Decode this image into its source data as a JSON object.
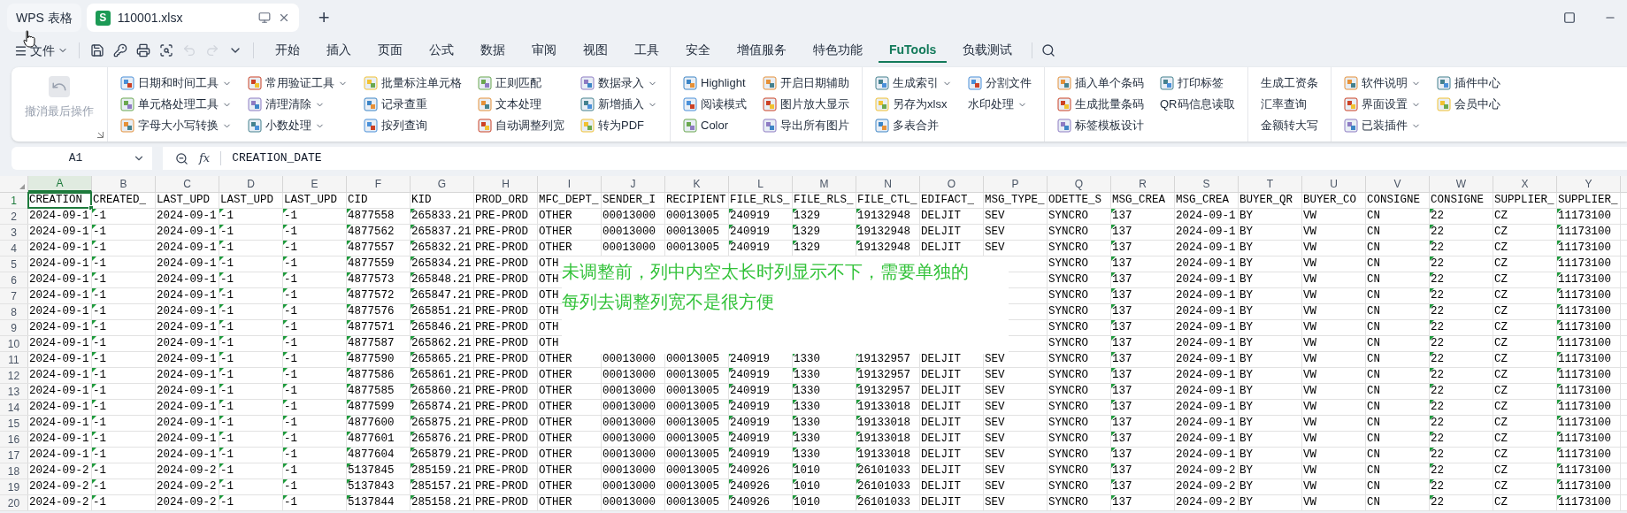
{
  "doc_tabs": [
    {
      "label": "WPS 表格",
      "kind": "home",
      "selected": false
    },
    {
      "label": "110001.xlsx",
      "kind": "sheet",
      "badge": "S",
      "selected": true
    }
  ],
  "new_tab": "+",
  "menu": {
    "file_label": "文件",
    "quick_tools": [
      {
        "kind": "save",
        "disabled": false
      },
      {
        "kind": "key",
        "disabled": false
      },
      {
        "kind": "print",
        "disabled": false
      },
      {
        "kind": "preview",
        "disabled": false
      },
      {
        "kind": "undo",
        "disabled": true
      },
      {
        "kind": "redo",
        "disabled": true
      },
      {
        "kind": "more",
        "disabled": false
      }
    ],
    "tabs": [
      {
        "label": "开始",
        "selected": false
      },
      {
        "label": "插入",
        "selected": false
      },
      {
        "label": "页面",
        "selected": false
      },
      {
        "label": "公式",
        "selected": false
      },
      {
        "label": "数据",
        "selected": false
      },
      {
        "label": "审阅",
        "selected": false
      },
      {
        "label": "视图",
        "selected": false
      },
      {
        "label": "工具",
        "selected": false
      },
      {
        "label": "安全",
        "selected": false
      },
      {
        "label": "增值服务",
        "selected": false
      },
      {
        "label": "特色功能",
        "selected": false
      },
      {
        "label": "FuTools",
        "selected": true
      },
      {
        "label": "负载测试",
        "selected": false
      }
    ]
  },
  "ribbon": {
    "undo_button": {
      "label": "撤消最后操作",
      "disabled": true
    },
    "groups": [
      {
        "columns": [
          [
            {
              "label": "日期和时间工具",
              "dropdown": true,
              "has_icon": true
            },
            {
              "label": "单元格处理工具",
              "dropdown": true,
              "has_icon": true
            },
            {
              "label": "字母大小写转换",
              "dropdown": true,
              "has_icon": true
            }
          ],
          [
            {
              "label": "常用验证工具",
              "dropdown": true,
              "has_icon": true
            },
            {
              "label": "清理清除",
              "dropdown": true,
              "has_icon": true
            },
            {
              "label": "小数处理",
              "dropdown": true,
              "has_icon": true
            }
          ],
          [
            {
              "label": "批量标注单元格",
              "dropdown": false,
              "has_icon": true
            },
            {
              "label": "记录查重",
              "dropdown": false,
              "has_icon": true
            },
            {
              "label": "按列查询",
              "dropdown": false,
              "has_icon": true
            }
          ],
          [
            {
              "label": "正则匹配",
              "dropdown": false,
              "has_icon": true
            },
            {
              "label": "文本处理",
              "dropdown": false,
              "has_icon": true
            },
            {
              "label": "自动调整列宽",
              "dropdown": false,
              "has_icon": true
            }
          ],
          [
            {
              "label": "数据录入",
              "dropdown": true,
              "has_icon": true
            },
            {
              "label": "新增插入",
              "dropdown": true,
              "has_icon": true
            },
            {
              "label": "转为PDF",
              "dropdown": false,
              "has_icon": true
            }
          ]
        ]
      },
      {
        "columns": [
          [
            {
              "label": "Highlight",
              "dropdown": false,
              "has_icon": true
            },
            {
              "label": "阅读模式",
              "dropdown": false,
              "has_icon": true
            },
            {
              "label": "Color",
              "dropdown": false,
              "has_icon": true
            }
          ],
          [
            {
              "label": "开启日期辅助",
              "dropdown": false,
              "has_icon": true
            },
            {
              "label": "图片放大显示",
              "dropdown": false,
              "has_icon": true
            },
            {
              "label": "导出所有图片",
              "dropdown": false,
              "has_icon": true
            }
          ]
        ]
      },
      {
        "columns": [
          [
            {
              "label": "生成索引",
              "dropdown": true,
              "has_icon": true
            },
            {
              "label": "另存为xlsx",
              "dropdown": false,
              "has_icon": true
            },
            {
              "label": "多表合并",
              "dropdown": false,
              "has_icon": true
            }
          ],
          [
            {
              "label": "分割文件",
              "dropdown": false,
              "has_icon": true
            },
            {
              "label": "水印处理",
              "dropdown": true,
              "has_icon": false
            }
          ]
        ]
      },
      {
        "columns": [
          [
            {
              "label": "插入单个条码",
              "dropdown": false,
              "has_icon": true
            },
            {
              "label": "生成批量条码",
              "dropdown": false,
              "has_icon": true
            },
            {
              "label": "标签模板设计",
              "dropdown": false,
              "has_icon": true
            }
          ],
          [
            {
              "label": "打印标签",
              "dropdown": false,
              "has_icon": true
            },
            {
              "label": "QR码信息读取",
              "dropdown": false,
              "has_icon": false
            }
          ]
        ]
      },
      {
        "columns": [
          [
            {
              "label": "生成工资条",
              "dropdown": false,
              "has_icon": false
            },
            {
              "label": "汇率查询",
              "dropdown": false,
              "has_icon": false
            },
            {
              "label": "金额转大写",
              "dropdown": false,
              "has_icon": false
            }
          ]
        ]
      },
      {
        "columns": [
          [
            {
              "label": "软件说明",
              "dropdown": true,
              "has_icon": true
            },
            {
              "label": "界面设置",
              "dropdown": true,
              "has_icon": true
            },
            {
              "label": "已装插件",
              "dropdown": true,
              "has_icon": true
            }
          ],
          [
            {
              "label": "插件中心",
              "dropdown": false,
              "has_icon": true
            },
            {
              "label": "会员中心",
              "dropdown": false,
              "has_icon": true
            }
          ]
        ]
      }
    ]
  },
  "formula_bar": {
    "name_box": "A1",
    "fx_label": "fx",
    "formula": "CREATION_DATE"
  },
  "sheet": {
    "columns": [
      {
        "letter": "A",
        "flag": false,
        "selected": true
      },
      {
        "letter": "B",
        "flag": true,
        "selected": false
      },
      {
        "letter": "C",
        "flag": false,
        "selected": false
      },
      {
        "letter": "D",
        "flag": true,
        "selected": false
      },
      {
        "letter": "E",
        "flag": true,
        "selected": false
      },
      {
        "letter": "F",
        "flag": true,
        "selected": false
      },
      {
        "letter": "G",
        "flag": true,
        "selected": false
      },
      {
        "letter": "H",
        "flag": false,
        "selected": false
      },
      {
        "letter": "I",
        "flag": false,
        "selected": false
      },
      {
        "letter": "J",
        "flag": false,
        "selected": false
      },
      {
        "letter": "K",
        "flag": false,
        "selected": false
      },
      {
        "letter": "L",
        "flag": true,
        "selected": false
      },
      {
        "letter": "M",
        "flag": true,
        "selected": false
      },
      {
        "letter": "N",
        "flag": true,
        "selected": false
      },
      {
        "letter": "O",
        "flag": false,
        "selected": false
      },
      {
        "letter": "P",
        "flag": false,
        "selected": false
      },
      {
        "letter": "Q",
        "flag": false,
        "selected": false
      },
      {
        "letter": "R",
        "flag": true,
        "selected": false
      },
      {
        "letter": "S",
        "flag": false,
        "selected": false
      },
      {
        "letter": "T",
        "flag": false,
        "selected": false
      },
      {
        "letter": "U",
        "flag": false,
        "selected": false
      },
      {
        "letter": "V",
        "flag": false,
        "selected": false
      },
      {
        "letter": "W",
        "flag": true,
        "selected": false
      },
      {
        "letter": "X",
        "flag": false,
        "selected": false
      },
      {
        "letter": "Y",
        "flag": true,
        "selected": false
      }
    ],
    "rows": [
      {
        "number": "1",
        "selected": true,
        "flagged": false,
        "cells": [
          "CREATION",
          "CREATED_",
          "LAST_UPD",
          "LAST_UPD",
          "LAST_UPD",
          "CID",
          "KID",
          "PROD_ORD",
          "MFC_DEPT_",
          "SENDER_I",
          "RECIPIENT",
          "FILE_RLS_",
          "FILE_RLS_",
          "FILE_CTL_",
          "EDIFACT_",
          "MSG_TYPE_",
          "ODETTE_S",
          "MSG_CREA",
          "MSG_CREA",
          "BUYER_QR",
          "BUYER_CO",
          "CONSIGNE",
          "CONSIGNE",
          "SUPPLIER_",
          "SUPPLIER_"
        ]
      },
      {
        "number": "2",
        "selected": false,
        "flagged": true,
        "cells": [
          "2024-09-1",
          "-1",
          "2024-09-1",
          "-1",
          "-1",
          "4877558",
          "265833.21",
          "PRE-PROD",
          "OTHER",
          "00013000",
          "00013005",
          "240919",
          "1329",
          "19132948",
          "DELJIT",
          "SEV",
          "SYNCRO",
          "137",
          "2024-09-1",
          "BY",
          "VW",
          "CN",
          "22",
          "CZ",
          "11173100"
        ]
      },
      {
        "number": "3",
        "selected": false,
        "flagged": true,
        "cells": [
          "2024-09-1",
          "-1",
          "2024-09-1",
          "-1",
          "-1",
          "4877562",
          "265837.21",
          "PRE-PROD",
          "OTHER",
          "00013000",
          "00013005",
          "240919",
          "1329",
          "19132948",
          "DELJIT",
          "SEV",
          "SYNCRO",
          "137",
          "2024-09-1",
          "BY",
          "VW",
          "CN",
          "22",
          "CZ",
          "11173100"
        ]
      },
      {
        "number": "4",
        "selected": false,
        "flagged": true,
        "cells": [
          "2024-09-1",
          "-1",
          "2024-09-1",
          "-1",
          "-1",
          "4877557",
          "265832.21",
          "PRE-PROD",
          "OTHER",
          "00013000",
          "00013005",
          "240919",
          "1329",
          "19132948",
          "DELJIT",
          "SEV",
          "SYNCRO",
          "137",
          "2024-09-1",
          "BY",
          "VW",
          "CN",
          "22",
          "CZ",
          "11173100"
        ]
      },
      {
        "number": "5",
        "selected": false,
        "flagged": true,
        "cells": [
          "2024-09-1",
          "-1",
          "2024-09-1",
          "-1",
          "-1",
          "4877559",
          "265834.21",
          "PRE-PROD",
          "OTH",
          null,
          null,
          null,
          null,
          null,
          null,
          null,
          "SYNCRO",
          "137",
          "2024-09-1",
          "BY",
          "VW",
          "CN",
          "22",
          "CZ",
          "11173100"
        ]
      },
      {
        "number": "6",
        "selected": false,
        "flagged": true,
        "cells": [
          "2024-09-1",
          "-1",
          "2024-09-1",
          "-1",
          "-1",
          "4877573",
          "265848.21",
          "PRE-PROD",
          "OTH",
          null,
          null,
          null,
          null,
          null,
          null,
          null,
          "SYNCRO",
          "137",
          "2024-09-1",
          "BY",
          "VW",
          "CN",
          "22",
          "CZ",
          "11173100"
        ]
      },
      {
        "number": "7",
        "selected": false,
        "flagged": true,
        "cells": [
          "2024-09-1",
          "-1",
          "2024-09-1",
          "-1",
          "-1",
          "4877572",
          "265847.21",
          "PRE-PROD",
          "OTH",
          null,
          null,
          null,
          null,
          null,
          null,
          null,
          "SYNCRO",
          "137",
          "2024-09-1",
          "BY",
          "VW",
          "CN",
          "22",
          "CZ",
          "11173100"
        ]
      },
      {
        "number": "8",
        "selected": false,
        "flagged": true,
        "cells": [
          "2024-09-1",
          "-1",
          "2024-09-1",
          "-1",
          "-1",
          "4877576",
          "265851.21",
          "PRE-PROD",
          "OTH",
          null,
          null,
          null,
          null,
          null,
          null,
          null,
          "SYNCRO",
          "137",
          "2024-09-1",
          "BY",
          "VW",
          "CN",
          "22",
          "CZ",
          "11173100"
        ]
      },
      {
        "number": "9",
        "selected": false,
        "flagged": true,
        "cells": [
          "2024-09-1",
          "-1",
          "2024-09-1",
          "-1",
          "-1",
          "4877571",
          "265846.21",
          "PRE-PROD",
          "OTH",
          null,
          null,
          null,
          null,
          null,
          null,
          null,
          "SYNCRO",
          "137",
          "2024-09-1",
          "BY",
          "VW",
          "CN",
          "22",
          "CZ",
          "11173100"
        ]
      },
      {
        "number": "10",
        "selected": false,
        "flagged": true,
        "cells": [
          "2024-09-1",
          "-1",
          "2024-09-1",
          "-1",
          "-1",
          "4877587",
          "265862.21",
          "PRE-PROD",
          "OTH",
          null,
          null,
          null,
          null,
          null,
          null,
          null,
          "SYNCRO",
          "137",
          "2024-09-1",
          "BY",
          "VW",
          "CN",
          "22",
          "CZ",
          "11173100"
        ]
      },
      {
        "number": "11",
        "selected": false,
        "flagged": true,
        "cells": [
          "2024-09-1",
          "-1",
          "2024-09-1",
          "-1",
          "-1",
          "4877590",
          "265865.21",
          "PRE-PROD",
          "OTHER",
          "00013000",
          "00013005",
          "240919",
          "1330",
          "19132957",
          "DELJIT",
          "SEV",
          "SYNCRO",
          "137",
          "2024-09-1",
          "BY",
          "VW",
          "CN",
          "22",
          "CZ",
          "11173100"
        ]
      },
      {
        "number": "12",
        "selected": false,
        "flagged": true,
        "cells": [
          "2024-09-1",
          "-1",
          "2024-09-1",
          "-1",
          "-1",
          "4877586",
          "265861.21",
          "PRE-PROD",
          "OTHER",
          "00013000",
          "00013005",
          "240919",
          "1330",
          "19132957",
          "DELJIT",
          "SEV",
          "SYNCRO",
          "137",
          "2024-09-1",
          "BY",
          "VW",
          "CN",
          "22",
          "CZ",
          "11173100"
        ]
      },
      {
        "number": "13",
        "selected": false,
        "flagged": true,
        "cells": [
          "2024-09-1",
          "-1",
          "2024-09-1",
          "-1",
          "-1",
          "4877585",
          "265860.21",
          "PRE-PROD",
          "OTHER",
          "00013000",
          "00013005",
          "240919",
          "1330",
          "19132957",
          "DELJIT",
          "SEV",
          "SYNCRO",
          "137",
          "2024-09-1",
          "BY",
          "VW",
          "CN",
          "22",
          "CZ",
          "11173100"
        ]
      },
      {
        "number": "14",
        "selected": false,
        "flagged": true,
        "cells": [
          "2024-09-1",
          "-1",
          "2024-09-1",
          "-1",
          "-1",
          "4877599",
          "265874.21",
          "PRE-PROD",
          "OTHER",
          "00013000",
          "00013005",
          "240919",
          "1330",
          "19133018",
          "DELJIT",
          "SEV",
          "SYNCRO",
          "137",
          "2024-09-1",
          "BY",
          "VW",
          "CN",
          "22",
          "CZ",
          "11173100"
        ]
      },
      {
        "number": "15",
        "selected": false,
        "flagged": true,
        "cells": [
          "2024-09-1",
          "-1",
          "2024-09-1",
          "-1",
          "-1",
          "4877600",
          "265875.21",
          "PRE-PROD",
          "OTHER",
          "00013000",
          "00013005",
          "240919",
          "1330",
          "19133018",
          "DELJIT",
          "SEV",
          "SYNCRO",
          "137",
          "2024-09-1",
          "BY",
          "VW",
          "CN",
          "22",
          "CZ",
          "11173100"
        ]
      },
      {
        "number": "16",
        "selected": false,
        "flagged": true,
        "cells": [
          "2024-09-1",
          "-1",
          "2024-09-1",
          "-1",
          "-1",
          "4877601",
          "265876.21",
          "PRE-PROD",
          "OTHER",
          "00013000",
          "00013005",
          "240919",
          "1330",
          "19133018",
          "DELJIT",
          "SEV",
          "SYNCRO",
          "137",
          "2024-09-1",
          "BY",
          "VW",
          "CN",
          "22",
          "CZ",
          "11173100"
        ]
      },
      {
        "number": "17",
        "selected": false,
        "flagged": true,
        "cells": [
          "2024-09-1",
          "-1",
          "2024-09-1",
          "-1",
          "-1",
          "4877604",
          "265879.21",
          "PRE-PROD",
          "OTHER",
          "00013000",
          "00013005",
          "240919",
          "1330",
          "19133018",
          "DELJIT",
          "SEV",
          "SYNCRO",
          "137",
          "2024-09-1",
          "BY",
          "VW",
          "CN",
          "22",
          "CZ",
          "11173100"
        ]
      },
      {
        "number": "18",
        "selected": false,
        "flagged": true,
        "cells": [
          "2024-09-2",
          "-1",
          "2024-09-2",
          "-1",
          "-1",
          "5137845",
          "285159.21",
          "PRE-PROD",
          "OTHER",
          "00013000",
          "00013005",
          "240926",
          "1010",
          "26101033",
          "DELJIT",
          "SEV",
          "SYNCRO",
          "137",
          "2024-09-2",
          "BY",
          "VW",
          "CN",
          "22",
          "CZ",
          "11173100"
        ]
      },
      {
        "number": "19",
        "selected": false,
        "flagged": true,
        "cells": [
          "2024-09-2",
          "-1",
          "2024-09-2",
          "-1",
          "-1",
          "5137843",
          "285157.21",
          "PRE-PROD",
          "OTHER",
          "00013000",
          "00013005",
          "240926",
          "1010",
          "26101033",
          "DELJIT",
          "SEV",
          "SYNCRO",
          "137",
          "2024-09-2",
          "BY",
          "VW",
          "CN",
          "22",
          "CZ",
          "11173100"
        ]
      },
      {
        "number": "20",
        "selected": false,
        "flagged": true,
        "cells": [
          "2024-09-2",
          "-1",
          "2024-09-2",
          "-1",
          "-1",
          "5137844",
          "285158.21",
          "PRE-PROD",
          "OTHER",
          "00013000",
          "00013005",
          "240926",
          "1010",
          "26101033",
          "DELJIT",
          "SEV",
          "SYNCRO",
          "137",
          "2024-09-2",
          "BY",
          "VW",
          "CN",
          "22",
          "CZ",
          "11173100"
        ]
      }
    ],
    "note": "未调整前，列中内空太长时列显示不下，需要单独的每列去调整列宽不是很方便"
  }
}
